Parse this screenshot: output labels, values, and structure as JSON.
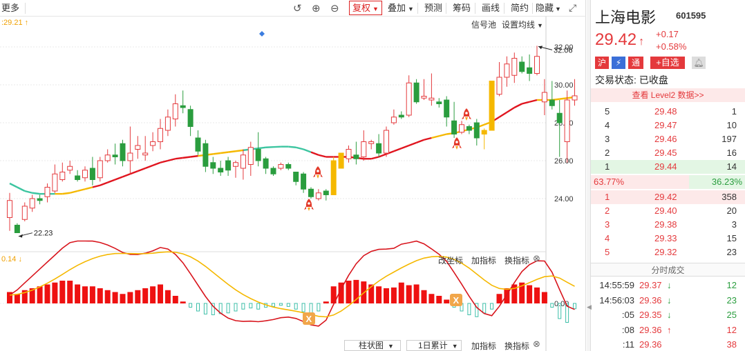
{
  "toolbar": {
    "more_label": "更多",
    "fq_label": "复权",
    "overlay_label": "叠加",
    "predict_label": "预测",
    "chip_label": "筹码",
    "draw_label": "画线",
    "simple_label": "简约",
    "hide_label": "隐藏"
  },
  "main_chart": {
    "ma_label": ":29.21",
    "signal_pool": "信号池",
    "ma_setting": "设置均线",
    "y_ticks": [
      "32.00",
      "30.00",
      "28.00",
      "26.00",
      "24.00"
    ],
    "high_label": "32.06",
    "low_label": "22.23"
  },
  "indicator": {
    "label": "0.14",
    "change_axis": "改坐标",
    "add_indicator": "加指标",
    "switch_indicator": "换指标",
    "zero_tick": "0.00"
  },
  "bottom_bar": {
    "bar_chart": "柱状图",
    "accum": "1日累计",
    "add_indicator": "加指标",
    "switch_indicator": "换指标"
  },
  "chart_data": {
    "type": "candlestick",
    "ylim": [
      22.0,
      33.0
    ],
    "candles": [
      [
        23.0,
        23.9,
        22.3,
        24.3
      ],
      [
        22.6,
        22.2,
        22.23,
        22.7
      ],
      [
        22.9,
        23.6,
        22.8,
        23.8
      ],
      [
        23.5,
        24.0,
        23.3,
        24.2
      ],
      [
        24.0,
        23.9,
        23.7,
        24.2
      ],
      [
        24.1,
        24.6,
        23.8,
        24.8
      ],
      [
        24.4,
        25.3,
        24.3,
        25.8
      ],
      [
        25.0,
        25.4,
        24.9,
        25.9
      ],
      [
        25.5,
        25.7,
        25.3,
        26.0
      ],
      [
        25.2,
        25.0,
        24.9,
        25.5
      ],
      [
        25.1,
        25.5,
        24.9,
        25.7
      ],
      [
        25.6,
        25.0,
        24.7,
        26.2
      ],
      [
        25.1,
        26.0,
        24.9,
        26.2
      ],
      [
        26.0,
        26.3,
        25.9,
        26.6
      ],
      [
        26.3,
        26.2,
        25.8,
        26.9
      ],
      [
        26.9,
        26.0,
        25.7,
        27.1
      ],
      [
        26.0,
        26.4,
        25.3,
        27.8
      ],
      [
        26.6,
        26.8,
        26.1,
        27.3
      ],
      [
        26.3,
        26.4,
        26.0,
        27.3
      ],
      [
        26.8,
        27.0,
        26.5,
        27.5
      ],
      [
        27.0,
        27.7,
        26.6,
        28.2
      ],
      [
        27.6,
        28.3,
        27.3,
        28.7
      ],
      [
        28.2,
        29.0,
        27.8,
        29.5
      ],
      [
        28.9,
        28.8,
        28.5,
        29.7
      ],
      [
        28.7,
        27.8,
        27.3,
        28.9
      ],
      [
        27.2,
        26.5,
        26.3,
        27.6
      ],
      [
        26.9,
        25.7,
        25.4,
        27.1
      ],
      [
        25.9,
        25.6,
        25.3,
        26.2
      ],
      [
        25.6,
        25.4,
        25.2,
        26.0
      ],
      [
        26.0,
        25.5,
        25.2,
        26.2
      ],
      [
        25.7,
        25.9,
        25.1,
        26.0
      ],
      [
        25.6,
        26.3,
        25.0,
        26.6
      ],
      [
        25.8,
        26.7,
        25.2,
        27.0
      ],
      [
        26.6,
        26.0,
        25.7,
        27.5
      ],
      [
        26.1,
        25.6,
        25.3,
        26.2
      ],
      [
        25.6,
        25.3,
        25.2,
        25.7
      ],
      [
        25.6,
        25.8,
        25.5,
        25.9
      ],
      [
        25.8,
        25.6,
        25.5,
        25.9
      ],
      [
        25.4,
        24.9,
        24.7,
        25.4
      ],
      [
        25.3,
        24.5,
        24.3,
        25.4
      ],
      [
        24.5,
        24.1,
        24.0,
        24.6
      ],
      [
        24.0,
        24.3,
        23.9,
        24.5
      ],
      [
        24.4,
        24.2,
        23.9,
        24.5
      ],
      [
        24.2,
        26.0,
        24.2,
        26.2
      ],
      [
        25.6,
        26.4,
        25.6,
        26.4
      ],
      [
        26.1,
        26.6,
        25.9,
        26.8
      ],
      [
        26.3,
        26.1,
        25.8,
        27.0
      ],
      [
        26.2,
        27.0,
        26.0,
        27.6
      ],
      [
        26.9,
        27.0,
        26.6,
        27.1
      ],
      [
        26.9,
        26.4,
        26.2,
        27.4
      ],
      [
        26.4,
        27.6,
        26.2,
        27.8
      ],
      [
        28.0,
        28.3,
        27.9,
        28.7
      ],
      [
        28.4,
        28.3,
        28.2,
        28.6
      ],
      [
        28.4,
        30.1,
        28.3,
        30.5
      ],
      [
        30.1,
        29.1,
        29.0,
        30.3
      ],
      [
        29.3,
        29.4,
        29.2,
        30.3
      ],
      [
        29.2,
        29.3,
        28.9,
        30.6
      ],
      [
        29.1,
        29.0,
        28.8,
        29.3
      ],
      [
        29.2,
        28.3,
        27.8,
        29.4
      ],
      [
        28.1,
        27.4,
        27.2,
        29.1
      ],
      [
        27.5,
        27.9,
        27.4,
        28.1
      ],
      [
        27.8,
        27.6,
        27.4,
        27.9
      ],
      [
        28.0,
        27.2,
        26.8,
        28.2
      ],
      [
        27.4,
        27.6,
        26.6,
        27.7
      ],
      [
        27.6,
        30.2,
        27.6,
        30.2
      ],
      [
        29.5,
        30.4,
        29.4,
        31.2
      ],
      [
        30.4,
        31.1,
        29.9,
        31.5
      ],
      [
        30.5,
        31.4,
        30.1,
        31.7
      ],
      [
        31.2,
        30.7,
        30.6,
        31.5
      ],
      [
        30.9,
        30.6,
        30.2,
        31.6
      ],
      [
        30.6,
        31.5,
        30.5,
        32.06
      ],
      [
        29.1,
        29.6,
        28.4,
        30.3
      ],
      [
        29.2,
        28.9,
        28.7,
        30.2
      ],
      [
        28.5,
        28.0,
        26.2,
        29.2
      ],
      [
        27.0,
        29.2,
        25.9,
        29.7
      ],
      [
        29.2,
        29.42,
        28.9,
        30.3
      ]
    ],
    "ma": [
      24.8,
      24.6,
      24.4,
      24.3,
      24.25,
      24.25,
      24.25,
      24.25,
      24.3,
      24.4,
      24.5,
      24.6,
      24.7,
      24.85,
      25.0,
      25.15,
      25.3,
      25.45,
      25.6,
      25.75,
      25.9,
      26.0,
      26.1,
      26.15,
      26.2,
      26.25,
      26.3,
      26.35,
      26.4,
      26.45,
      26.5,
      26.55,
      26.6,
      26.65,
      26.7,
      26.72,
      26.74,
      26.74,
      26.7,
      26.6,
      26.45,
      26.3,
      26.2,
      26.2,
      26.2,
      26.2,
      26.15,
      26.1,
      26.1,
      26.2,
      26.35,
      26.5,
      26.65,
      26.8,
      26.95,
      27.1,
      27.2,
      27.3,
      27.4,
      27.45,
      27.55,
      27.65,
      27.75,
      27.9,
      28.05,
      28.3,
      28.55,
      28.8,
      29.0,
      29.1,
      29.2,
      29.2,
      29.2,
      29.25,
      29.3,
      29.35
    ],
    "macd": [
      0.3,
      0.25,
      0.35,
      0.4,
      0.45,
      0.5,
      0.55,
      0.6,
      0.6,
      0.5,
      0.45,
      0.45,
      0.4,
      0.35,
      0.3,
      0.25,
      0.3,
      0.35,
      0.4,
      0.45,
      0.5,
      0.35,
      0.2,
      0.05,
      -0.1,
      -0.2,
      -0.28,
      -0.3,
      -0.27,
      -0.25,
      -0.2,
      -0.15,
      -0.12,
      -0.15,
      -0.1,
      -0.08,
      -0.05,
      -0.08,
      -0.15,
      -0.22,
      -0.25,
      -0.2,
      0.05,
      0.45,
      0.55,
      0.6,
      0.62,
      0.58,
      0.5,
      0.45,
      0.4,
      0.42,
      0.55,
      0.48,
      0.5,
      0.35,
      0.25,
      0.2,
      0.1,
      -0.1,
      -0.2,
      -0.3,
      -0.35,
      -0.25,
      -0.15,
      0.25,
      0.4,
      0.5,
      0.55,
      0.48,
      0.42,
      0.3,
      -0.1,
      -0.4,
      -0.5,
      -0.14
    ]
  },
  "stock": {
    "name": "上海电影",
    "code": "601595",
    "price": "29.42",
    "change": "+0.17",
    "change_pct": "+0.58%",
    "tag_hu": "沪",
    "tag_flash": "⚡",
    "tag_tong": "通",
    "add_fav": "+自选",
    "status_label": "交易状态:",
    "status_value": "已收盘",
    "level2": "查看 Level2 数据>>",
    "asks": [
      {
        "lvl": "5",
        "price": "29.48",
        "vol": "1"
      },
      {
        "lvl": "4",
        "price": "29.47",
        "vol": "10"
      },
      {
        "lvl": "3",
        "price": "29.46",
        "vol": "197"
      },
      {
        "lvl": "2",
        "price": "29.45",
        "vol": "16"
      },
      {
        "lvl": "1",
        "price": "29.44",
        "vol": "14"
      }
    ],
    "ratio_left": "63.77%",
    "ratio_right": "36.23%",
    "bids": [
      {
        "lvl": "1",
        "price": "29.42",
        "vol": "358"
      },
      {
        "lvl": "2",
        "price": "29.40",
        "vol": "20"
      },
      {
        "lvl": "3",
        "price": "29.38",
        "vol": "3"
      },
      {
        "lvl": "4",
        "price": "29.33",
        "vol": "15"
      },
      {
        "lvl": "5",
        "price": "29.32",
        "vol": "23"
      }
    ],
    "ticks_title": "分时成交",
    "ticks": [
      {
        "time": "14:55:59",
        "price": "29.37",
        "dir": "↓",
        "vol": "12"
      },
      {
        "time": "14:56:03",
        "price": "29.36",
        "dir": "↓",
        "vol": "23"
      },
      {
        "time": ":05",
        "price": "29.35",
        "dir": "↓",
        "vol": "25"
      },
      {
        "time": ":08",
        "price": "29.36",
        "dir": "↑",
        "vol": "12"
      },
      {
        "time": ":11",
        "price": "29.36",
        "dir": "",
        "vol": "38"
      }
    ]
  },
  "colors": {
    "up": "#e4393c",
    "down": "#2a9d3e",
    "ma_red": "#e0141e",
    "ma_yellow": "#f5b800",
    "ma_green": "#3cc5a0"
  }
}
